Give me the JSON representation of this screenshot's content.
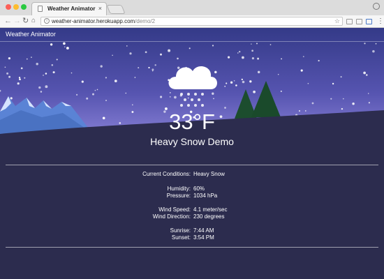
{
  "browser": {
    "tab_title": "Weather Animator",
    "tab_close": "×",
    "url_domain": "weather-animator.herokuapp.com",
    "url_path": "/demo/2"
  },
  "app": {
    "name": "Weather Animator"
  },
  "weather": {
    "temperature": "33°F",
    "title": "Heavy Snow Demo"
  },
  "details": [
    {
      "label": "Current Conditions:",
      "value": "Heavy Snow"
    },
    {
      "label": "Humidity:",
      "value": "60%"
    },
    {
      "label": "Pressure:",
      "value": "1034 hPa"
    },
    {
      "label": "Wind Speed:",
      "value": "4.1 meter/sec"
    },
    {
      "label": "Wind Direction:",
      "value": "230 degrees"
    },
    {
      "label": "Sunrise:",
      "value": "7:44 AM"
    },
    {
      "label": "Sunset:",
      "value": "3:54 PM"
    }
  ],
  "colors": {
    "sky_top": "#3d4290",
    "sky_bottom": "#8c82d8",
    "ground": "#2c2c4e",
    "mountain": "#5b84d6",
    "tree": "#1b4a2c"
  },
  "icons": {
    "weather": "heavy-snow-cloud-icon"
  }
}
